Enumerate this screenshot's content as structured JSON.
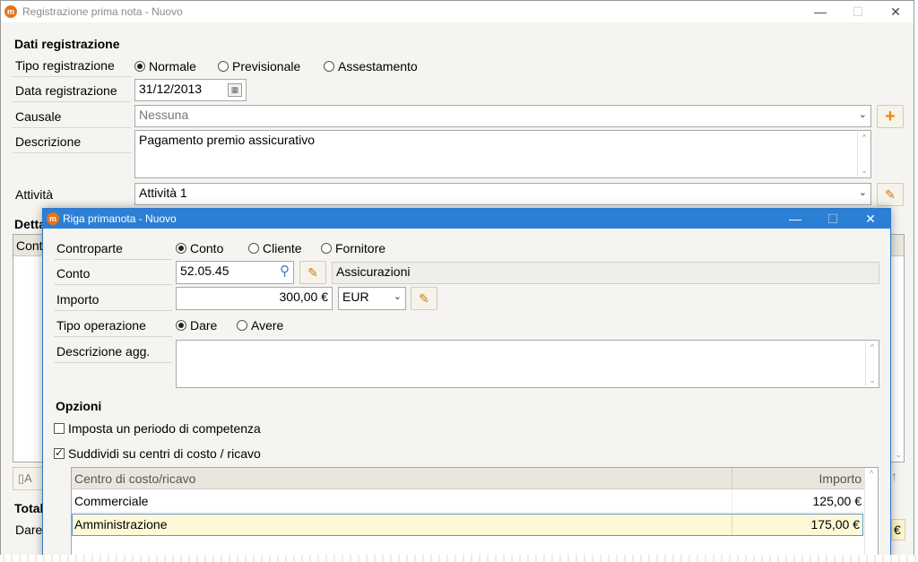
{
  "main_window": {
    "title": "Registrazione prima nota - Nuovo",
    "icon": "app-logo-icon",
    "controls": {
      "minimize": "—",
      "maximize": "☐",
      "close": "✕"
    }
  },
  "dati_registrazione": {
    "title": "Dati registrazione",
    "tipo_label": "Tipo registrazione",
    "tipo_options": [
      "Normale",
      "Previsionale",
      "Assestamento"
    ],
    "tipo_selected": "Normale",
    "data_label": "Data registrazione",
    "data_value": "31/12/2013",
    "causale_label": "Causale",
    "causale_value": "Nessuna",
    "descrizione_label": "Descrizione",
    "descrizione_value": "Pagamento premio assicurativo",
    "attivita_label": "Attività",
    "attivita_value": "Attività 1"
  },
  "background_partial": {
    "dettaglio_label": "Detta",
    "table_header_partial": "Cont",
    "add_button_partial": "A",
    "totali_label": "Total",
    "dare_label": "Dare",
    "currency_partial": "€"
  },
  "dialog": {
    "title": "Riga primanota - Nuovo",
    "controls": {
      "minimize": "—",
      "maximize": "☐",
      "close": "✕"
    },
    "controparte_label": "Controparte",
    "controparte_options": [
      "Conto",
      "Cliente",
      "Fornitore"
    ],
    "controparte_selected": "Conto",
    "conto_label": "Conto",
    "conto_value": "52.05.45",
    "conto_description": "Assicurazioni",
    "importo_label": "Importo",
    "importo_value": "300,00 €",
    "valuta_value": "EUR",
    "tipo_operazione_label": "Tipo operazione",
    "tipo_operazione_options": [
      "Dare",
      "Avere"
    ],
    "tipo_operazione_selected": "Dare",
    "descrizione_agg_label": "Descrizione agg.",
    "descrizione_agg_value": "",
    "opzioni_title": "Opzioni",
    "periodo_label": "Imposta un periodo di competenza",
    "periodo_checked": false,
    "centri_label": "Suddividi su centri di costo / ricavo",
    "centri_checked": true,
    "table": {
      "headers": [
        "Centro di costo/ricavo",
        "Importo"
      ],
      "rows": [
        {
          "centro": "Commerciale",
          "importo": "125,00 €"
        },
        {
          "centro": "Amministrazione",
          "importo": "175,00 €"
        }
      ]
    }
  },
  "colors": {
    "accent_blue": "#2b7fd4",
    "selected_row": "#fdf8d6",
    "app_icon": "#e8731a"
  }
}
